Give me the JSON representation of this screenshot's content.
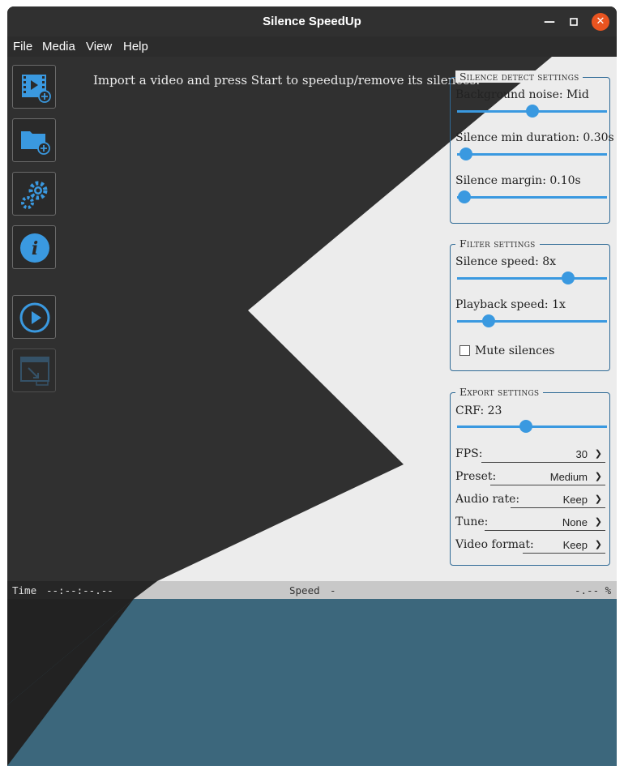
{
  "window": {
    "title": "Silence SpeedUp"
  },
  "menu": {
    "file": "File",
    "media": "Media",
    "view": "View",
    "help": "Help"
  },
  "toolbar": {
    "buttons": [
      {
        "icon": "import-video-icon"
      },
      {
        "icon": "import-folder-icon"
      },
      {
        "icon": "settings-gears-icon"
      },
      {
        "icon": "info-icon"
      },
      {
        "icon": "play-icon"
      },
      {
        "icon": "export-icon",
        "disabled": true
      }
    ]
  },
  "hint_text": "Import a video and press Start to speedup/remove its silences.",
  "silence_detect": {
    "title": "Silence detect settings",
    "background_noise_label": "Background noise: Mid",
    "background_noise_level": 0.5,
    "min_duration_label": "Silence min duration: 0.30s",
    "min_duration_level": 0.06,
    "margin_label": "Silence margin: 0.10s",
    "margin_level": 0.05
  },
  "filter": {
    "title": "Filter settings",
    "silence_speed_label": "Silence speed: 8x",
    "silence_speed_level": 0.74,
    "playback_speed_label": "Playback speed: 1x",
    "playback_speed_level": 0.21,
    "mute_label": "Mute silences",
    "mute_checked": false
  },
  "export": {
    "title": "Export settings",
    "crf_label": "CRF: 23",
    "crf_level": 0.46,
    "fps_label": "FPS:",
    "fps_value": "30",
    "preset_label": "Preset:",
    "preset_value": "Medium",
    "audio_rate_label": "Audio rate:",
    "audio_rate_value": "Keep",
    "tune_label": "Tune:",
    "tune_value": "None",
    "video_format_label": "Video format:",
    "video_format_value": "Keep"
  },
  "status": {
    "time_label": "Time",
    "time_value": "--:--:--.--",
    "speed_label": "Speed",
    "speed_value": "-",
    "progress_text": "-.-- %"
  },
  "colors": {
    "accent": "#3a99e0",
    "light_bg": "#ececec",
    "dark_bg": "#303030",
    "teal_bg": "#3c677c",
    "close_button": "#e95420"
  }
}
